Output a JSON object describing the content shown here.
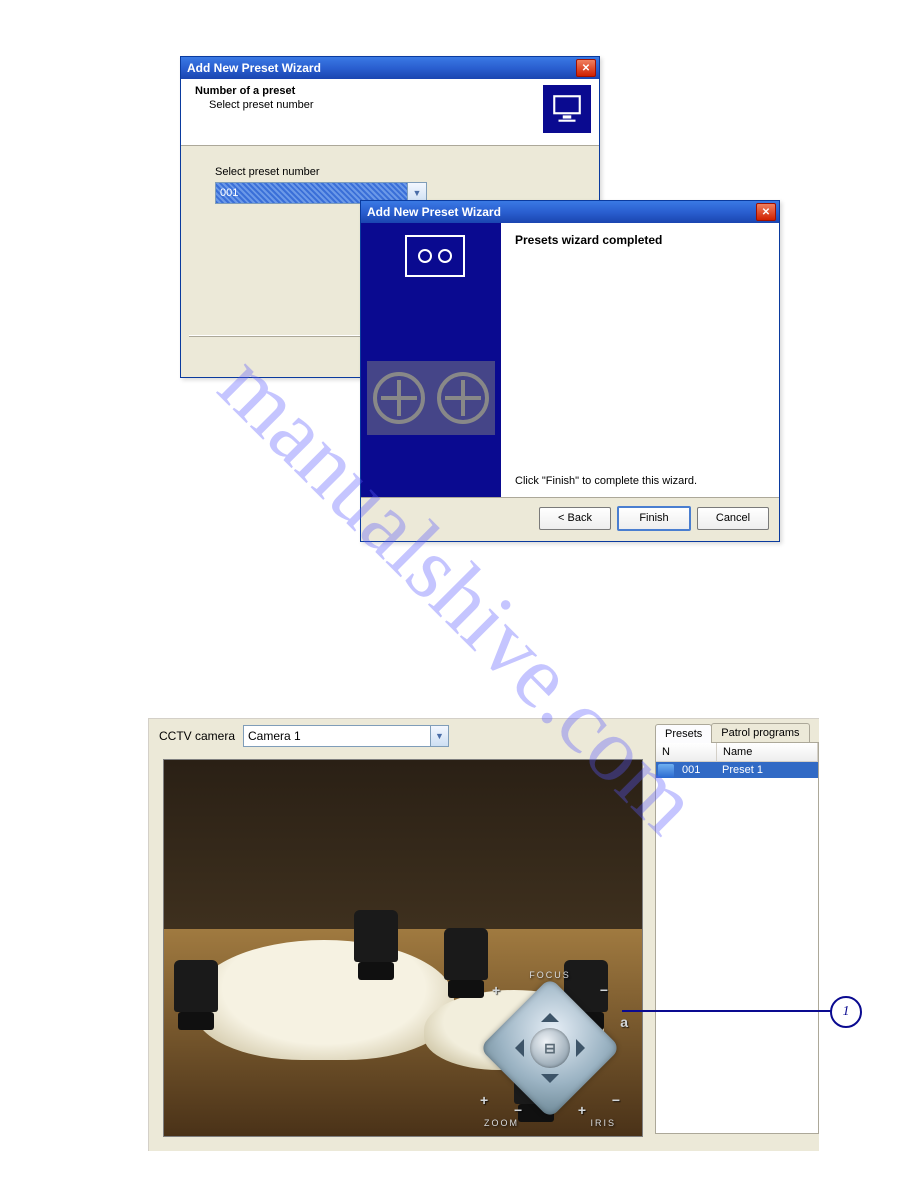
{
  "watermark": "manualshive.com",
  "dialog1": {
    "title": "Add New Preset Wizard",
    "header_title": "Number of a preset",
    "header_sub": "Select preset number",
    "label": "Select preset number",
    "combo_value": "001"
  },
  "dialog2": {
    "title": "Add New Preset Wizard",
    "heading": "Presets wizard completed",
    "finish_text": "Click \"Finish\" to complete this wizard.",
    "back": "< Back",
    "finish": "Finish",
    "cancel": "Cancel"
  },
  "panel": {
    "camera_label": "CCTV camera",
    "camera_value": "Camera 1",
    "tabs": {
      "presets": "Presets",
      "patrol": "Patrol programs"
    },
    "columns": {
      "n": "N",
      "name": "Name"
    },
    "row": {
      "n": "001",
      "name": "Preset 1"
    },
    "ptz": {
      "focus": "FOCUS",
      "zoom": "ZOOM",
      "iris": "IRIS",
      "plus": "+",
      "minus": "−"
    }
  },
  "callout": "1"
}
